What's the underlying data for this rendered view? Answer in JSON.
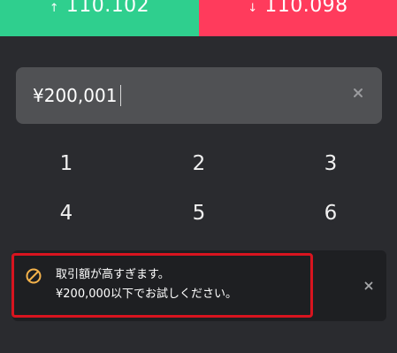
{
  "top_buttons": {
    "buy": {
      "arrow": "↑",
      "price": "110.102",
      "color": "#2fcf8e"
    },
    "sell": {
      "arrow": "↓",
      "price": "110.098",
      "color": "#ff3b5c"
    }
  },
  "amount_input": {
    "value": "¥200,001",
    "clear_icon": "close-icon"
  },
  "keypad": {
    "keys": [
      "1",
      "2",
      "3",
      "4",
      "5",
      "6"
    ]
  },
  "toast": {
    "icon": "prohibited-icon",
    "icon_color": "#f4b24b",
    "line1": "取引額が高すぎます。",
    "line2": "¥200,000以下でお試しください。",
    "close_icon": "close-icon",
    "highlight_color": "#d8141f"
  }
}
